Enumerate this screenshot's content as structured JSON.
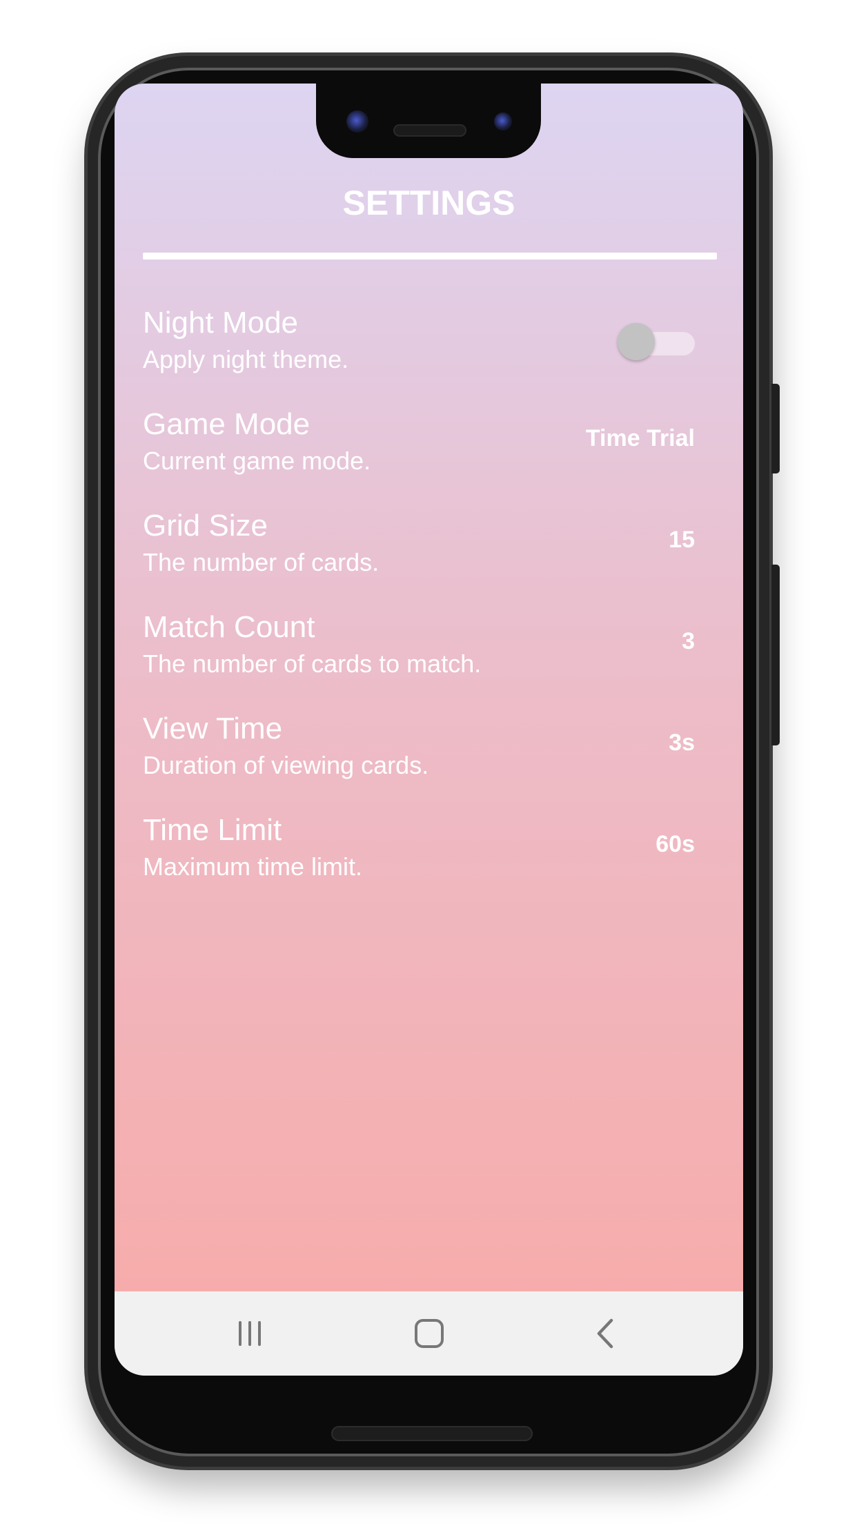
{
  "screen": {
    "title": "SETTINGS"
  },
  "settings": [
    {
      "title": "Night Mode",
      "subtitle": "Apply night theme.",
      "control": "toggle",
      "enabled": false
    },
    {
      "title": "Game Mode",
      "subtitle": "Current game mode.",
      "value": "Time Trial"
    },
    {
      "title": "Grid Size",
      "subtitle": "The number of cards.",
      "value": "15"
    },
    {
      "title": "Match Count",
      "subtitle": "The number of cards to match.",
      "value": "3"
    },
    {
      "title": "View Time",
      "subtitle": "Duration of viewing cards.",
      "value": "3s"
    },
    {
      "title": "Time Limit",
      "subtitle": "Maximum time limit.",
      "value": "60s"
    }
  ],
  "navbar": {
    "icons": [
      "recent-apps-icon",
      "home-icon",
      "back-icon"
    ]
  },
  "colors": {
    "gradient_top": "#ddd5f2",
    "gradient_bottom": "#f8aaa7",
    "text": "#ffffff",
    "toggle_thumb": "#c2c2c2",
    "navbar_background": "#f1f1f1",
    "nav_icon": "#777777"
  }
}
